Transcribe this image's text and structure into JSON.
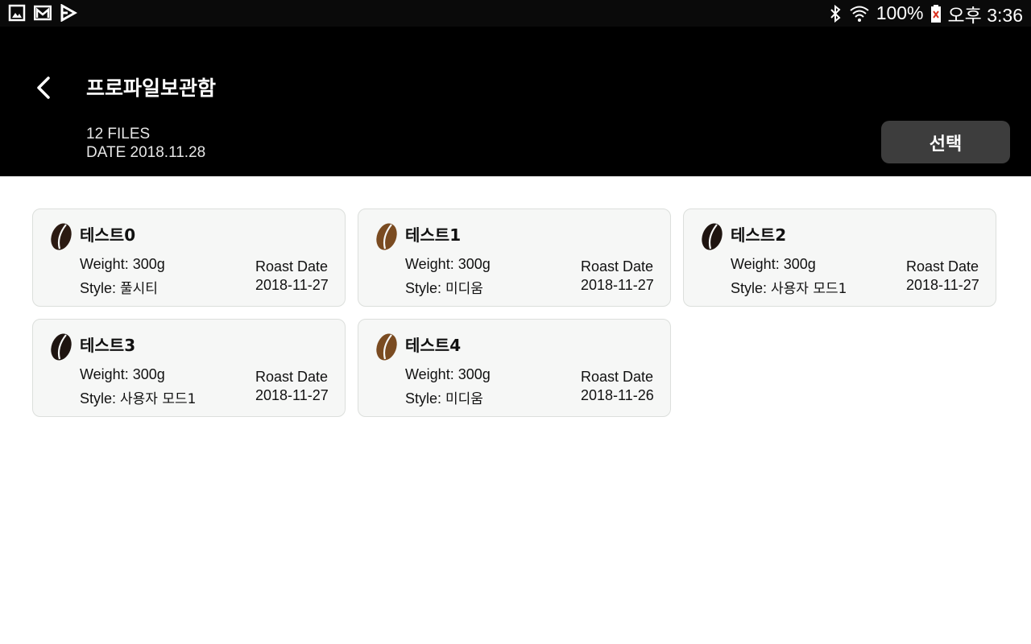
{
  "status_bar": {
    "left_icons": [
      "gallery-icon",
      "mail-icon",
      "play-store-icon"
    ],
    "battery": "100%",
    "time": "오후 3:36",
    "right_icons": [
      "bluetooth-icon",
      "wifi-icon",
      "battery-icon"
    ]
  },
  "header": {
    "title": "프로파일보관함",
    "files_count": "12 FILES",
    "date": "DATE 2018.11.28",
    "select_label": "선택"
  },
  "colors": {
    "dark_bean": "#2b1a12",
    "light_bean": "#7a4b21",
    "card_bg": "#f6f7f6"
  },
  "cards": [
    {
      "name": "테스트0",
      "weight": "Weight: 300g",
      "style_prefix": "Style: ",
      "style": "풀시티",
      "roast_label": "Roast Date",
      "roast_date": "2018-11-27",
      "bean": "dark"
    },
    {
      "name": "테스트1",
      "weight": "Weight: 300g",
      "style_prefix": "Style: ",
      "style": "미디움",
      "roast_label": "Roast Date",
      "roast_date": "2018-11-27",
      "bean": "light"
    },
    {
      "name": "테스트2",
      "weight": "Weight: 300g",
      "style_prefix": "Style: ",
      "style": "사용자 모드1",
      "roast_label": "Roast Date",
      "roast_date": "2018-11-27",
      "bean": "dark"
    },
    {
      "name": "테스트3",
      "weight": "Weight: 300g",
      "style_prefix": "Style: ",
      "style": "사용자 모드1",
      "roast_label": "Roast Date",
      "roast_date": "2018-11-27",
      "bean": "dark"
    },
    {
      "name": "테스트4",
      "weight": "Weight: 300g",
      "style_prefix": "Style: ",
      "style": "미디움",
      "roast_label": "Roast Date",
      "roast_date": "2018-11-26",
      "bean": "light"
    }
  ]
}
